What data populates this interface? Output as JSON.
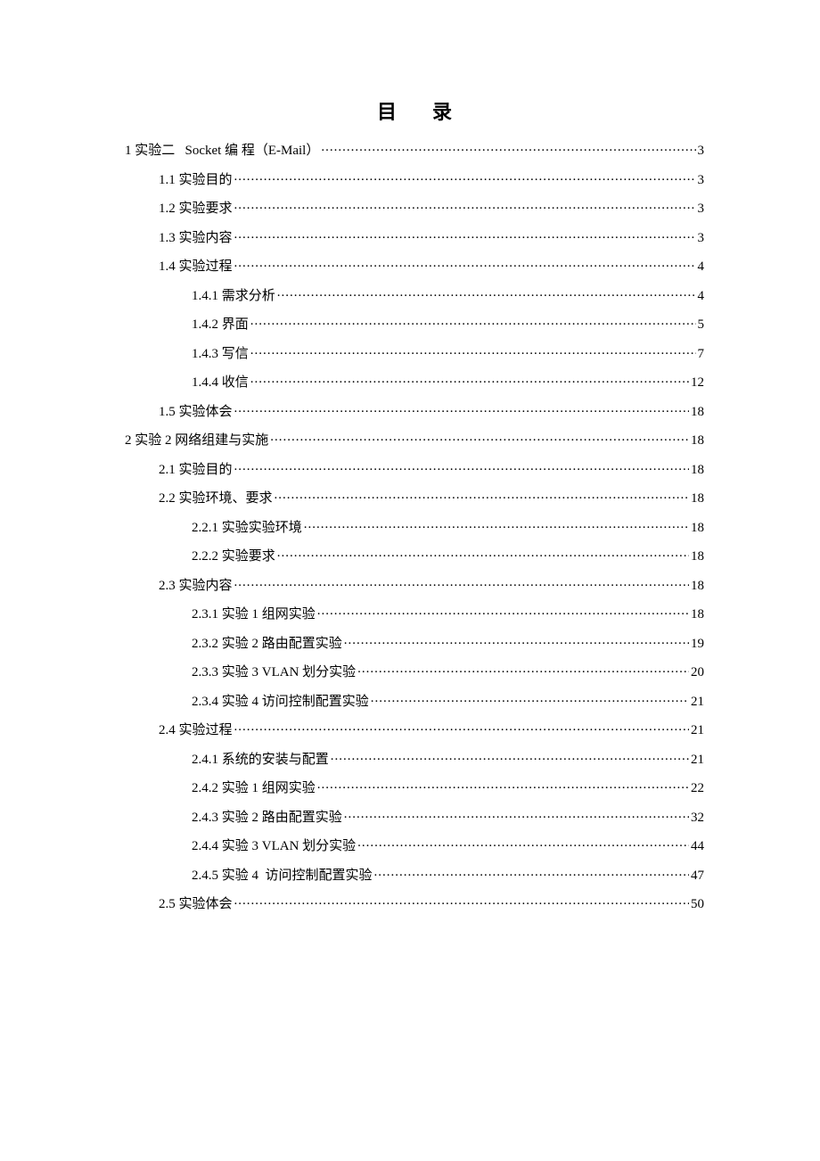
{
  "title": "目录",
  "entries": [
    {
      "indent": 0,
      "label": "1 实验二   Socket 编 程（E-Mail）",
      "page": "3"
    },
    {
      "indent": 1,
      "label": "1.1 实验目的",
      "page": "3"
    },
    {
      "indent": 1,
      "label": "1.2 实验要求",
      "page": "3"
    },
    {
      "indent": 1,
      "label": "1.3 实验内容",
      "page": "3"
    },
    {
      "indent": 1,
      "label": "1.4 实验过程",
      "page": "4"
    },
    {
      "indent": 2,
      "label": "1.4.1 需求分析",
      "page": "4"
    },
    {
      "indent": 2,
      "label": "1.4.2 界面",
      "page": "5"
    },
    {
      "indent": 2,
      "label": "1.4.3 写信",
      "page": "7"
    },
    {
      "indent": 2,
      "label": "1.4.4 收信",
      "page": "12"
    },
    {
      "indent": 1,
      "label": "1.5 实验体会",
      "page": "18"
    },
    {
      "indent": 0,
      "label": "2 实验 2 网络组建与实施",
      "page": "18"
    },
    {
      "indent": 1,
      "label": "2.1 实验目的",
      "page": "18"
    },
    {
      "indent": 1,
      "label": "2.2 实验环境、要求",
      "page": "18"
    },
    {
      "indent": 2,
      "label": "2.2.1 实验实验环境",
      "page": "18"
    },
    {
      "indent": 2,
      "label": "2.2.2 实验要求",
      "page": "18"
    },
    {
      "indent": 1,
      "label": "2.3 实验内容",
      "page": "18"
    },
    {
      "indent": 2,
      "label": "2.3.1 实验 1 组网实验",
      "page": "18"
    },
    {
      "indent": 2,
      "label": "2.3.2 实验 2 路由配置实验",
      "page": "19"
    },
    {
      "indent": 2,
      "label": "2.3.3 实验 3 VLAN 划分实验",
      "page": "20"
    },
    {
      "indent": 2,
      "label": "2.3.4 实验 4 访问控制配置实验",
      "page": "21"
    },
    {
      "indent": 1,
      "label": "2.4 实验过程",
      "page": "21"
    },
    {
      "indent": 2,
      "label": "2.4.1 系统的安装与配置",
      "page": "21"
    },
    {
      "indent": 2,
      "label": "2.4.2 实验 1 组网实验",
      "page": "22"
    },
    {
      "indent": 2,
      "label": "2.4.3 实验 2 路由配置实验",
      "page": "32"
    },
    {
      "indent": 2,
      "label": "2.4.4 实验 3 VLAN 划分实验",
      "page": "44"
    },
    {
      "indent": 2,
      "label": "2.4.5 实验 4  访问控制配置实验",
      "page": "47"
    },
    {
      "indent": 1,
      "label": "2.5 实验体会",
      "page": "50"
    }
  ]
}
